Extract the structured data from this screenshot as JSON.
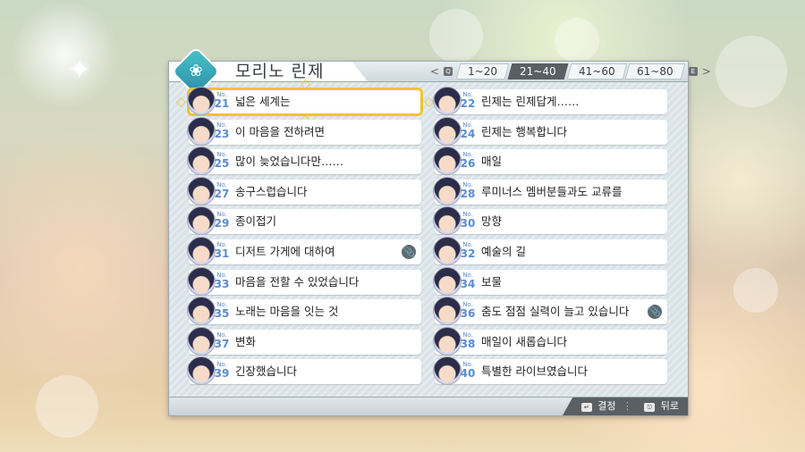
{
  "character_name": "모리노 린제",
  "tabs": [
    {
      "label": "1~20",
      "active": false
    },
    {
      "label": "21~40",
      "active": true
    },
    {
      "label": "41~60",
      "active": false
    },
    {
      "label": "61~80",
      "active": false
    }
  ],
  "no_prefix": "No.",
  "left_items": [
    {
      "no": "21",
      "title": "넓은 세계는",
      "selected": true,
      "clip": false
    },
    {
      "no": "23",
      "title": "이 마음을 전하려면",
      "selected": false,
      "clip": false
    },
    {
      "no": "25",
      "title": "많이 늦었습니다만……",
      "selected": false,
      "clip": false
    },
    {
      "no": "27",
      "title": "송구스럽습니다",
      "selected": false,
      "clip": false
    },
    {
      "no": "29",
      "title": "종이접기",
      "selected": false,
      "clip": false
    },
    {
      "no": "31",
      "title": "디저트 가게에 대하여",
      "selected": false,
      "clip": true
    },
    {
      "no": "33",
      "title": "마음을 전할 수 있었습니다",
      "selected": false,
      "clip": false
    },
    {
      "no": "35",
      "title": "노래는 마음을 잇는 것",
      "selected": false,
      "clip": false
    },
    {
      "no": "37",
      "title": "변화",
      "selected": false,
      "clip": false
    },
    {
      "no": "39",
      "title": "긴장했습니다",
      "selected": false,
      "clip": false
    }
  ],
  "right_items": [
    {
      "no": "22",
      "title": "린제는 린제답게……",
      "selected": false,
      "clip": false
    },
    {
      "no": "24",
      "title": "린제는 행복합니다",
      "selected": false,
      "clip": false
    },
    {
      "no": "26",
      "title": "매일",
      "selected": false,
      "clip": false
    },
    {
      "no": "28",
      "title": "루미너스 멤버분들과도 교류를",
      "selected": false,
      "clip": false
    },
    {
      "no": "30",
      "title": "망향",
      "selected": false,
      "clip": false
    },
    {
      "no": "32",
      "title": "예술의 길",
      "selected": false,
      "clip": false
    },
    {
      "no": "34",
      "title": "보물",
      "selected": false,
      "clip": false
    },
    {
      "no": "36",
      "title": "춤도 점점 실력이 늘고 있습니다",
      "selected": false,
      "clip": true
    },
    {
      "no": "38",
      "title": "매일이 새롭습니다",
      "selected": false,
      "clip": false
    },
    {
      "no": "40",
      "title": "특별한 라이브였습니다",
      "selected": false,
      "clip": false
    }
  ],
  "footer": {
    "confirm_label": "결정",
    "back_label": "뒤로"
  },
  "icons": {
    "emblem": "character-emblem-icon",
    "clip": "paperclip-icon",
    "prev": "chevron-left-icon",
    "next": "chevron-right-icon"
  },
  "colors": {
    "selection": "#f2c230",
    "active_tab": "#5a5f63",
    "number": "#5a8ccf"
  }
}
